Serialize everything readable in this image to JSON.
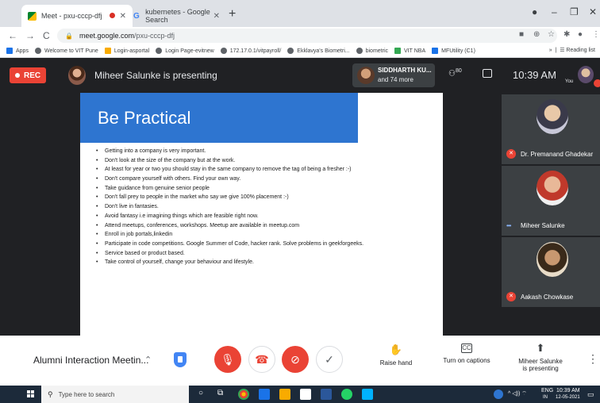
{
  "browser": {
    "tabs": [
      {
        "title": "Meet - pxu-cccp-dfj",
        "active": true,
        "recording": true
      },
      {
        "title": "kubernetes - Google Search",
        "active": false
      }
    ],
    "url_host": "meet.google.com",
    "url_path": "/pxu-cccp-dfj",
    "bookmarks": [
      "Apps",
      "Welcome to VIT Pune",
      "Login-asportal",
      "Login Page-evitnew",
      "172.17.0.1/vitpayroll/",
      "Ekklavya's Biometri...",
      "biometric",
      "VIT NBA",
      "MFUtility (C1)"
    ],
    "reading_list": "Reading list"
  },
  "meet": {
    "rec_label": "REC",
    "presenting_banner": "Miheer Salunke is presenting",
    "viewer_name": "SIDDHARTH KU...",
    "viewer_more": "and 74 more",
    "people_count": "80",
    "time": "10:39 AM",
    "you_label": "You"
  },
  "slide": {
    "title": "Be Practical",
    "bullets": [
      "Getting into a company is very important.",
      "Don't look at the size of the company but at the work.",
      " At least for year or two you should stay in the same company to remove the tag of being a fresher :-)",
      "Don't compare yourself with others. Find your own way.",
      "Take guidance from genuine senior people",
      "Don't fall prey to people in the market who say we give 100% placement :-)",
      "Don't live in fantasies.",
      "Avoid fantasy  i.e imagining things which are feasible right now.",
      "Attend meetups, conferences, workshops. Meetup are available in meetup.com",
      "Enroll in job portals,linkedin",
      "Participate in code competitions. Google Summer of Code, hacker rank. Solve problems in geekforgeeks.",
      "Service based or product based.",
      "Take control of yourself, change your behaviour and lifestyle."
    ]
  },
  "participants": [
    {
      "name": "Dr. Premanand Ghadekar",
      "muted": true
    },
    {
      "name": "Miheer Salunke",
      "muted": false
    },
    {
      "name": "Aakash Chowkase",
      "muted": true
    }
  ],
  "controls": {
    "meeting_title": "Alumni Interaction Meetin...",
    "raise_hand": "Raise hand",
    "captions": "Turn on captions",
    "captions_icon": "CC",
    "presenting_line1": "Miheer Salunke",
    "presenting_line2": "is presenting"
  },
  "taskbar": {
    "search_placeholder": "Type here to search",
    "lang1": "ENG",
    "lang2": "IN",
    "time": "10:39 AM",
    "date": "12-05-2021"
  }
}
